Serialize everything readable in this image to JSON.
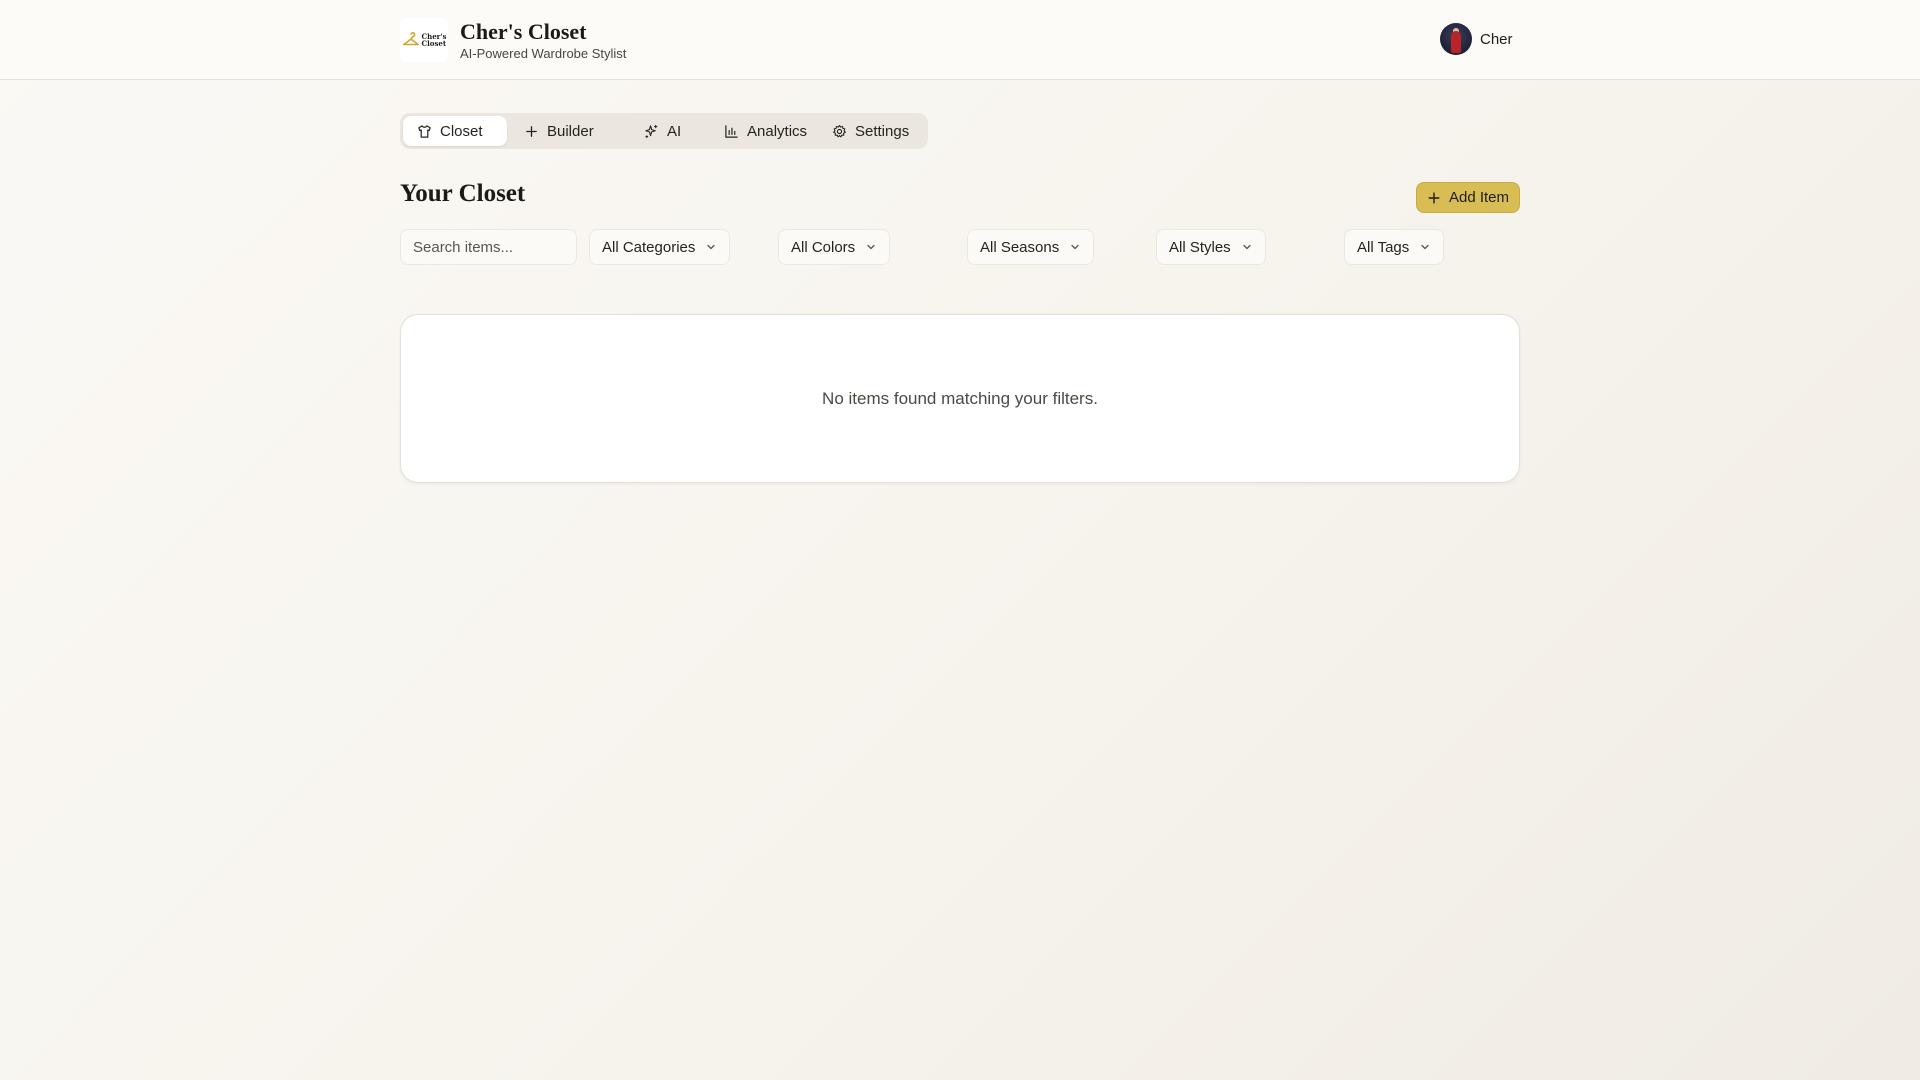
{
  "app": {
    "title": "Cher's Closet",
    "subtitle": "AI-Powered Wardrobe Stylist",
    "logo_text_1": "Cher's",
    "logo_text_2": "Closet"
  },
  "user": {
    "name": "Cher"
  },
  "tabs": [
    {
      "label": "Closet",
      "icon": "shirt-icon",
      "active": true
    },
    {
      "label": "Builder",
      "icon": "plus-icon",
      "active": false
    },
    {
      "label": "AI",
      "icon": "sparkles-icon",
      "active": false
    },
    {
      "label": "Analytics",
      "icon": "bar-chart-icon",
      "active": false
    },
    {
      "label": "Settings",
      "icon": "gear-icon",
      "active": false
    }
  ],
  "main": {
    "title": "Your Closet",
    "add_label": "Add Item",
    "empty_message": "No items found matching your filters."
  },
  "filters": {
    "search_placeholder": "Search items...",
    "categories": "All Categories",
    "colors": "All Colors",
    "seasons": "All Seasons",
    "styles": "All Styles",
    "tags": "All Tags"
  },
  "colors": {
    "accent": "#d8bd55",
    "background": "#f7f4ee"
  }
}
